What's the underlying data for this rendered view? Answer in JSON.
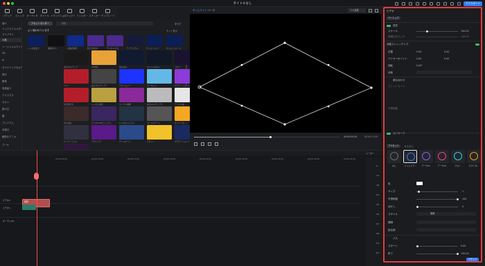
{
  "title_bar": {
    "title": "タイトルなし",
    "export_label": "エクスポート"
  },
  "media_tabs": [
    "メディア",
    "ストック",
    "オーディオ",
    "タイトル",
    "トランジション",
    "エフェクト",
    "フィルター",
    "ステッカー",
    "テンプレート"
  ],
  "sidebar": {
    "items": [
      "個人",
      "ミックスフォルダー",
      "ライブラリ",
      "人気",
      "ソーシャルメディア",
      "3D",
      "Ai",
      "ダイナミックなカウントダウン",
      "旅行",
      "教育",
      "商品紹介",
      "クリスマス",
      "ネオン",
      "夏の日",
      "春",
      "プレミアム",
      "手描き",
      "最新＆アニメ",
      "ブーケ"
    ]
  },
  "browser": {
    "asset_center": "アセットセンター",
    "search_placeholder": "検索",
    "all_label": "すべて",
    "section_title": "よく使われています",
    "more_label": "もっと見る",
    "captions": [
      "レイの出会う",
      "報酬あり2",
      "山積の場所",
      "飾り方法の5",
      "デジタル人気",
      "アンチュラル",
      "サイエンスシー",
      "サイエンスシー2",
      "ある3Dメディア",
      "3D流星",
      "電子系の...",
      "タイトルボタン",
      "フロー",
      "ブルー",
      "ある3Dメディア2",
      "テクノロジー",
      "ワンウェブ",
      "グラデーション3",
      "星の輝き光",
      "レイのと電気",
      "ワンプル映像",
      "ある3Dメディア3",
      "デジタル品",
      "光の演出",
      "デジタル4Dビジュアル",
      "レイのビジュアル",
      "ワンプルアート",
      "サイバーな...",
      "ワンサーフェス",
      "アウトドア",
      "ゲームボード",
      "アグリー",
      "グラデーション2",
      "ゲーム文字"
    ]
  },
  "preview": {
    "tab_timeline": "タイムライン",
    "tab_source": "ソース",
    "quality": "フル品質",
    "time_current": "00:00:00:00",
    "time_total": "00:00:11:00"
  },
  "inspector": {
    "tabs": [
      "ビデオ",
      "オーディオ",
      "カラー",
      "速度"
    ],
    "sub_tab": "ベーシック",
    "transform": {
      "label": "変形",
      "scale_label": "スケール",
      "scale_value": "100.00",
      "uniform_label": "縦横比をロック",
      "uniform_value": "100.00",
      "position_label": "位置",
      "pos_x": "0.00",
      "pos_y": "0.00",
      "anchor_label": "アンカーポイント",
      "anchor_x": "0.00",
      "anchor_y": "0.00",
      "rotate_label": "回転",
      "rotate_value": "0.00°",
      "flip_label": "反転"
    },
    "auto_fit_label": "自動ストレッチング",
    "blend": {
      "label": "重ね合わせ",
      "mode_label": "ブレンドモード",
      "opacity_label": "不透明度"
    },
    "effect_section": "ストローク",
    "presets": {
      "label": "プリセット",
      "custom": "カスタム",
      "items": [
        "なし",
        "ソリッドア...",
        "アーク01",
        "アーク02",
        "グロー",
        "カランダ..."
      ]
    },
    "fields": {
      "color": "色",
      "size": "サイズ",
      "size_value": "1",
      "opacity": "不透明度",
      "opacity_value": "100",
      "blur": "ぼかし",
      "blur_value": "0",
      "style": "スタイル",
      "style_value": "実線",
      "spacing": "間隔",
      "join": "結合部",
      "path": "パス",
      "start": "スタート",
      "start_value": "0.00",
      "end": "終了",
      "end_value": "100.00"
    },
    "ok_label": "リセット"
  },
  "timeline": {
    "ruler": [
      "00:00:05:00",
      "00:00:10:00",
      "00:00:15:00",
      "00:00:20:00",
      "00:00:25:00",
      "00:00:30:00",
      "00:00:35:00",
      "00:00:40:00",
      "00:00:45:00"
    ],
    "tracks": [
      "ビデオ2",
      "ビデオ1",
      "オーディオ1"
    ],
    "clip_label": "図形",
    "db_ticks": [
      "-6",
      "-12",
      "-18",
      "-24",
      "-30",
      "-36",
      "-42",
      "-48",
      "-54",
      "-60"
    ],
    "meter_label": "メーター"
  }
}
